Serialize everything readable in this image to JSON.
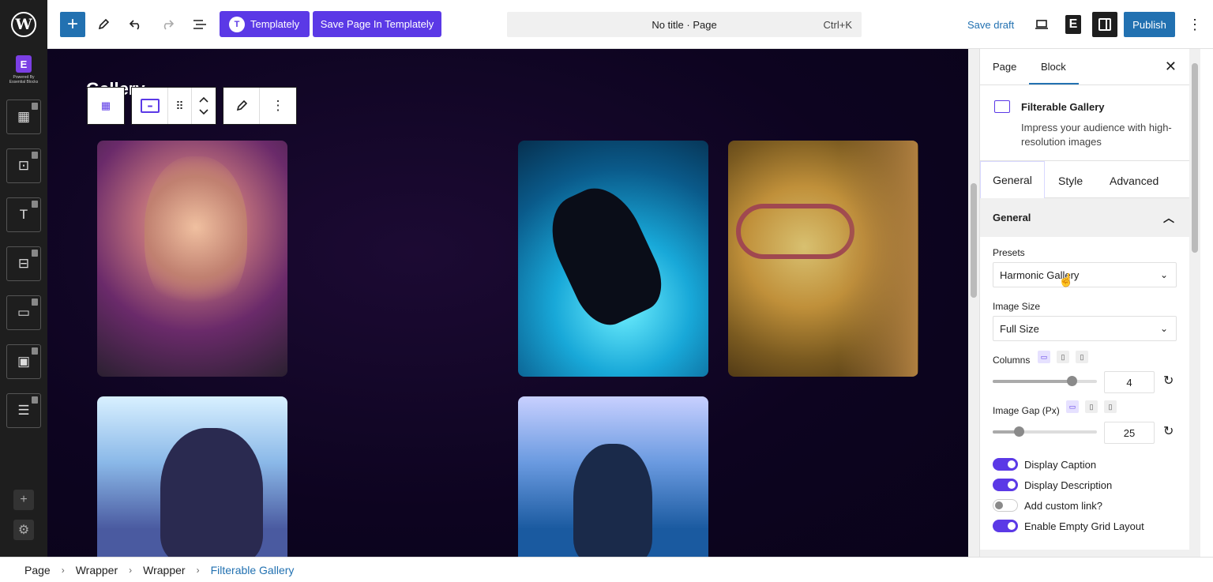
{
  "header": {
    "templately_label": "Templately",
    "save_in_templately_label": "Save Page In Templately",
    "command_title": "No title · Page",
    "command_shortcut": "Ctrl+K",
    "save_draft_label": "Save draft",
    "publish_label": "Publish"
  },
  "leftbar": {
    "powered_by": "Powered By Essential Blocks"
  },
  "canvas": {
    "gallery_title": "Gallery"
  },
  "sidebar": {
    "tab_page": "Page",
    "tab_block": "Block",
    "block_title": "Filterable Gallery",
    "block_description": "Impress your audience with high-resolution images",
    "subtab_general": "General",
    "subtab_style": "Style",
    "subtab_advanced": "Advanced",
    "panel_title": "General",
    "presets_label": "Presets",
    "presets_value": "Harmonic Gallery",
    "image_size_label": "Image Size",
    "image_size_value": "Full Size",
    "columns_label": "Columns",
    "columns_value": "4",
    "columns_fraction": 0.76,
    "image_gap_label": "Image Gap (Px)",
    "image_gap_value": "25",
    "image_gap_fraction": 0.25,
    "display_caption_label": "Display Caption",
    "display_description_label": "Display Description",
    "add_custom_link_label": "Add custom link?",
    "empty_grid_label": "Enable Empty Grid Layout"
  },
  "breadcrumb": {
    "items": [
      "Page",
      "Wrapper",
      "Wrapper",
      "Filterable Gallery"
    ]
  },
  "colors": {
    "accent": "#2271b1",
    "templately": "#5b39e6",
    "canvas_bg": "#0d0420"
  }
}
